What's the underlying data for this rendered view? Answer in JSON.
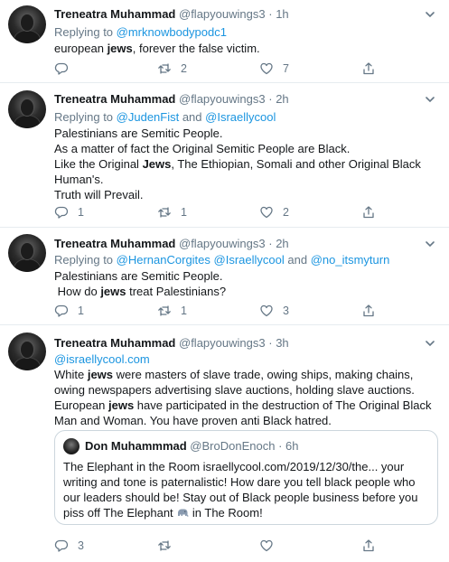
{
  "colors": {
    "link": "#1b95e0",
    "muted": "#657786",
    "divider": "#e6ecf0"
  },
  "tweets": [
    {
      "name": "Treneatra Muhammad",
      "handle": "@flapyouwings3",
      "dot": "·",
      "time": "1h",
      "replying_prefix": "Replying to ",
      "replying": [
        "@mrknowbodypodc1"
      ],
      "text": [
        "european ",
        "jews",
        ", forever the false victim."
      ],
      "replies": "",
      "retweets": "2",
      "likes": "7"
    },
    {
      "name": "Treneatra Muhammad",
      "handle": "@flapyouwings3",
      "dot": "·",
      "time": "2h",
      "replying_prefix": "Replying to ",
      "replying": [
        "@JudenFist",
        " and ",
        "@Israellycool"
      ],
      "lines": [
        "Palestinians are Semitic People.",
        "As a matter of fact the Original Semitic People are Black.",
        [
          "Like the Original ",
          "Jews",
          ", The Ethiopian, Somali and other Original Black"
        ],
        "Human's.",
        "Truth will Prevail."
      ],
      "replies": "1",
      "retweets": "1",
      "likes": "2"
    },
    {
      "name": "Treneatra Muhammad",
      "handle": "@flapyouwings3",
      "dot": "·",
      "time": "2h",
      "replying_prefix": "Replying to ",
      "replying": [
        "@HernanCorgites",
        " ",
        "@Israellycool",
        " and ",
        "@no_itsmyturn"
      ],
      "lines": [
        "Palestinians are Semitic People.",
        [
          " How do ",
          "jews",
          " treat Palestinians?"
        ]
      ],
      "replies": "1",
      "retweets": "1",
      "likes": "3"
    },
    {
      "name": "Treneatra Muhammad",
      "handle": "@flapyouwings3",
      "dot": "·",
      "time": "3h",
      "mention_line": "@israellycool.com",
      "text": [
        "White ",
        "jews",
        " were masters of slave trade, owing ships, making chains, owing newspapers advertising slave auctions, holding slave auctions. European ",
        "jews",
        " have participated in the destruction of The Original Black Man and Woman. You have proven anti Black hatred."
      ],
      "quote": {
        "name": "Don Muhammmad",
        "handle": "@BroDonEnoch",
        "dot": "·",
        "time": "6h",
        "text_before": "The Elephant in the Room israellycool.com/2019/12/30/the... your writing and tone is paternalistic! How dare you tell black people who our leaders should be! Stay out of Black people business before you piss off The Elephant ",
        "emoji": "elephant",
        "text_after": " in The Room!"
      },
      "replies": "3",
      "retweets": "",
      "likes": ""
    }
  ]
}
